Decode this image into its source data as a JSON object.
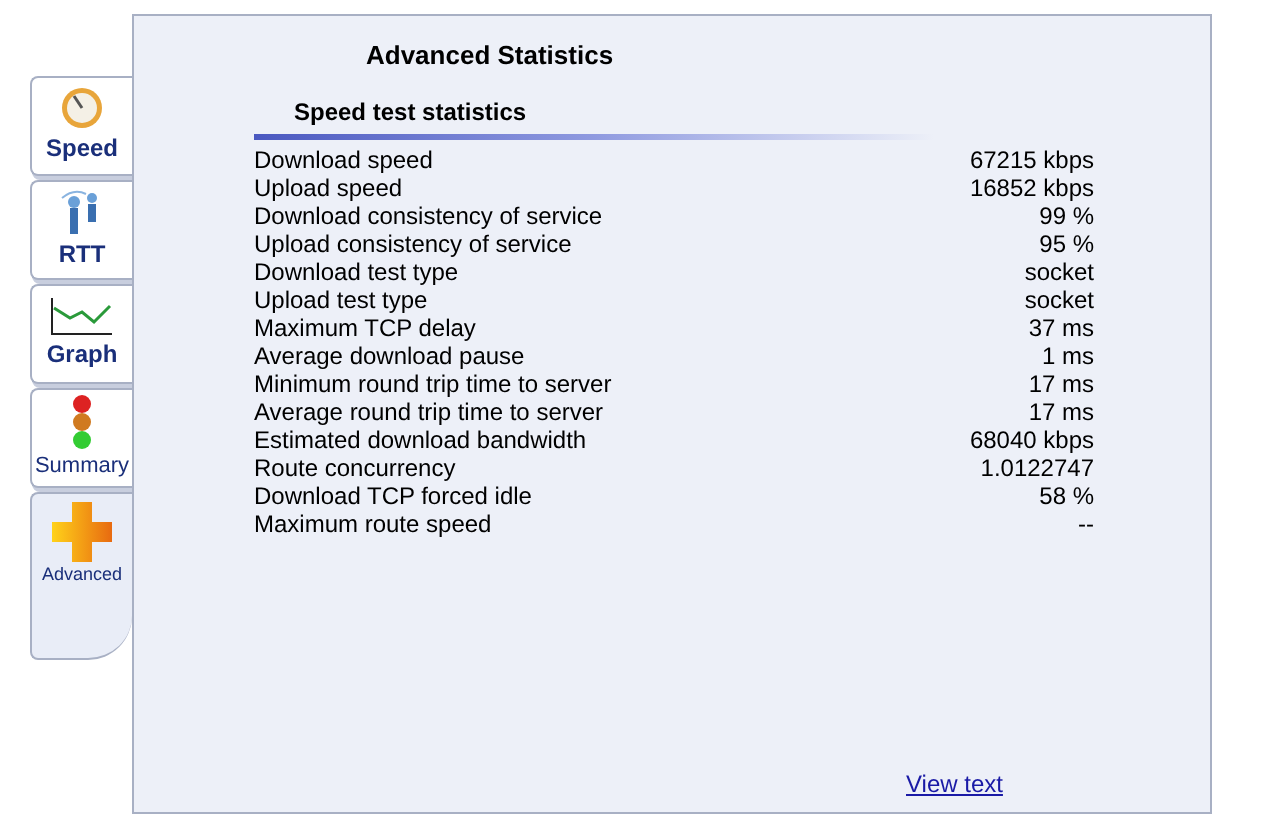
{
  "tabs": [
    {
      "label": "Speed",
      "kind": "gauge",
      "selected": false
    },
    {
      "label": "RTT",
      "kind": "antenna",
      "selected": false
    },
    {
      "label": "Graph",
      "kind": "graph",
      "selected": false
    },
    {
      "label": "Summary",
      "kind": "lights",
      "selected": false
    },
    {
      "label": "Advanced",
      "kind": "plus",
      "selected": true
    }
  ],
  "title": "Advanced Statistics",
  "section": "Speed test statistics",
  "stats": [
    {
      "label": "Download speed",
      "value": "67215 kbps"
    },
    {
      "label": "Upload speed",
      "value": "16852 kbps"
    },
    {
      "label": "Download consistency of service",
      "value": "99 %"
    },
    {
      "label": "Upload consistency of service",
      "value": "95 %"
    },
    {
      "label": "Download test type",
      "value": "socket"
    },
    {
      "label": "Upload test type",
      "value": "socket"
    },
    {
      "label": "Maximum TCP delay",
      "value": "37 ms"
    },
    {
      "label": "Average download pause",
      "value": "1 ms"
    },
    {
      "label": "Minimum round trip time to server",
      "value": "17 ms"
    },
    {
      "label": "Average round trip time to server",
      "value": "17 ms"
    },
    {
      "label": "Estimated download bandwidth",
      "value": "68040 kbps"
    },
    {
      "label": "Route concurrency",
      "value": "1.0122747"
    },
    {
      "label": "Download TCP forced idle",
      "value": "58 %"
    },
    {
      "label": "Maximum route speed",
      "value": "--"
    }
  ],
  "link": "View text"
}
